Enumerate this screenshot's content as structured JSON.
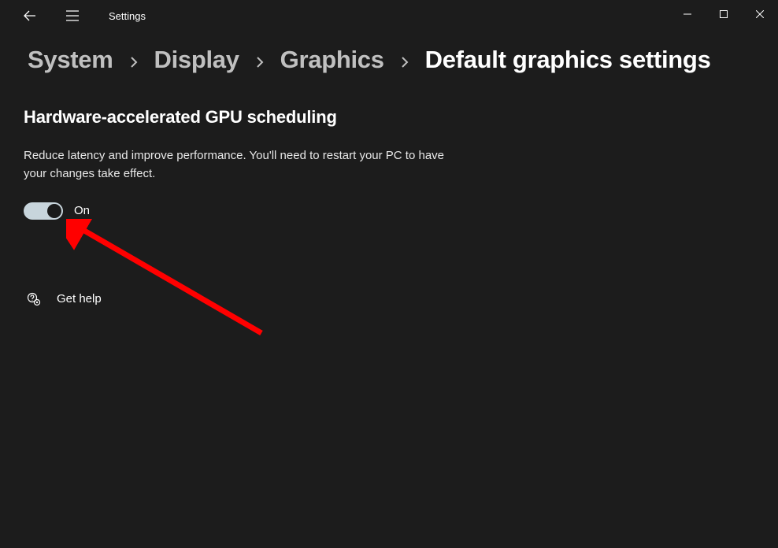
{
  "app": {
    "title": "Settings"
  },
  "breadcrumb": {
    "items": [
      {
        "label": "System"
      },
      {
        "label": "Display"
      },
      {
        "label": "Graphics"
      },
      {
        "label": "Default graphics settings"
      }
    ]
  },
  "section": {
    "title": "Hardware-accelerated GPU scheduling",
    "description": "Reduce latency and improve performance. You'll need to restart your PC to have your changes take effect."
  },
  "toggle": {
    "state": "On",
    "on": true
  },
  "help": {
    "label": "Get help"
  }
}
